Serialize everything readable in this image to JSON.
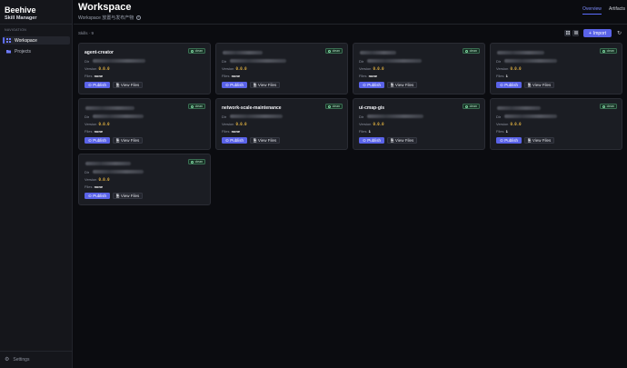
{
  "app": {
    "title": "Beehive",
    "subtitle": "Skill Manager"
  },
  "sidebar": {
    "heading": "NAVIGATION",
    "items": [
      {
        "label": "Workspace",
        "icon": "grid-icon",
        "active": true
      },
      {
        "label": "Projects",
        "icon": "folder-icon",
        "active": false
      }
    ],
    "settings_label": "Settings"
  },
  "header": {
    "title": "Workspace",
    "subtitle": "Workspace 放置与发布产物",
    "tabs": [
      {
        "label": "Overview",
        "active": true
      },
      {
        "label": "Artifacts",
        "active": false
      }
    ]
  },
  "toolbar": {
    "skills_count": "Skills · 9",
    "import_label": "Import"
  },
  "card_labels": {
    "dir": "Dir",
    "version": "Version",
    "files": "Files",
    "publish": "Publish",
    "view_files": "View Files",
    "badge": "clean"
  },
  "skills": [
    {
      "name": "agent-creator",
      "name_redacted": false,
      "version": "0.0.0",
      "files": "none"
    },
    {
      "name": "",
      "name_redacted": true,
      "version": "0.0.0",
      "files": "none"
    },
    {
      "name": "",
      "name_redacted": true,
      "version": "0.0.0",
      "files": "none"
    },
    {
      "name": "",
      "name_redacted": true,
      "version": "0.0.0",
      "files": "1"
    },
    {
      "name": "",
      "name_redacted": true,
      "version": "0.0.0",
      "files": "none"
    },
    {
      "name": "network-scale-maintenance",
      "name_redacted": false,
      "version": "0.0.0",
      "files": "none"
    },
    {
      "name": "ui-cmap-gis",
      "name_redacted": false,
      "version": "0.0.0",
      "files": "1"
    },
    {
      "name": "",
      "name_redacted": true,
      "version": "0.0.0",
      "files": "1"
    },
    {
      "name": "",
      "name_redacted": true,
      "version": "0.0.0",
      "files": "none"
    }
  ],
  "colors": {
    "accent": "#5a63e8",
    "version": "#e3b341",
    "badge_text": "#b5e6c8",
    "background": "#0b0c10",
    "card": "#1b1d23"
  }
}
